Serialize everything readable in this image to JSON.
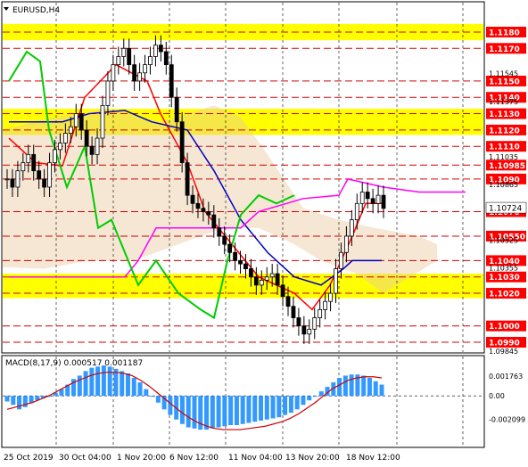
{
  "symbol_label": "EURUSD,H4",
  "macd_label": "MACD(8,17,9) 0.000517 0.001187",
  "price_scale": [
    1.1198,
    1.0984
  ],
  "macd_scale": [
    0.0035,
    -0.0045
  ],
  "colors": {
    "zone": "#ffff00",
    "redline": "#d40000",
    "candle_up": "#000000",
    "candle_down": "#000000",
    "tenkan": "#ff0000",
    "kijun": "#0000c0",
    "chikou": "#00cc00",
    "senkou_span_b": "#ff00ff",
    "kumo": "#e8c9a0",
    "macd_hist": "#3399ff",
    "macd_signal": "#cc0000",
    "label_bg": "#ff0000",
    "label_text": "#ffffff"
  },
  "levels": [
    {
      "price": "1.1180",
      "value": 1.118,
      "zone": true
    },
    {
      "price": "1.1170",
      "value": 1.117
    },
    {
      "price": "1.1150",
      "value": 1.115
    },
    {
      "price": "1.1140",
      "value": 1.114
    },
    {
      "price": "1.1130",
      "value": 1.113,
      "zone": true
    },
    {
      "price": "1.1120",
      "value": 1.112,
      "zone": true
    },
    {
      "price": "1.1110",
      "value": 1.111
    },
    {
      "price": "1.10985",
      "value": 1.10985
    },
    {
      "price": "1.1090",
      "value": 1.109
    },
    {
      "price": "1.1070",
      "value": 1.107
    },
    {
      "price": "1.10550",
      "value": 1.1055
    },
    {
      "price": "1.1040",
      "value": 1.104
    },
    {
      "price": "1.1030",
      "value": 1.103,
      "zone": true
    },
    {
      "price": "1.1020",
      "value": 1.102,
      "zone": true
    },
    {
      "price": "1.1000",
      "value": 1.1
    },
    {
      "price": "1.0990",
      "value": 1.099
    }
  ],
  "price_axis_ticks": [
    {
      "text": "1.11545",
      "value": 1.11545
    },
    {
      "text": "1.11375",
      "value": 1.11375
    },
    {
      "text": "1.11035",
      "value": 1.11035
    },
    {
      "text": "1.10865",
      "value": 1.10865
    },
    {
      "text": "1.10355",
      "value": 1.10355
    },
    {
      "text": "1.10525",
      "value": 1.10525
    },
    {
      "text": "1.09845",
      "value": 1.09845
    }
  ],
  "current_price": {
    "text": "1.10724",
    "value": 1.10724
  },
  "macd_axis_ticks": [
    {
      "text": "0.001763",
      "value": 0.001763
    },
    {
      "text": "0.00",
      "value": 0.0
    },
    {
      "text": "-0.002099",
      "value": -0.002099
    }
  ],
  "time_labels": [
    "25 Oct 2019",
    "30 Oct 04:00",
    "1 Nov 20:00",
    "6 Nov 12:00",
    "11 Nov 04:00",
    "13 Nov 20:00",
    "18 Nov 12:00"
  ],
  "chart_data": {
    "type": "candlestick",
    "symbol": "EURUSD",
    "timeframe": "H4",
    "candles_close": [
      1.109,
      1.1085,
      1.1095,
      1.11,
      1.1105,
      1.1095,
      1.109,
      1.1085,
      1.11,
      1.1108,
      1.1112,
      1.1118,
      1.1122,
      1.113,
      1.112,
      1.111,
      1.1105,
      1.1115,
      1.1135,
      1.115,
      1.116,
      1.1165,
      1.117,
      1.116,
      1.115,
      1.1155,
      1.116,
      1.1165,
      1.1172,
      1.1168,
      1.116,
      1.114,
      1.1125,
      1.11,
      1.108,
      1.1075,
      1.1072,
      1.107,
      1.1068,
      1.106,
      1.1055,
      1.105,
      1.1045,
      1.104,
      1.1038,
      1.1035,
      1.103,
      1.1025,
      1.1028,
      1.103,
      1.1032,
      1.1025,
      1.1018,
      1.1012,
      1.1005,
      1.1,
      1.0995,
      1.0998,
      1.1005,
      1.101,
      1.1015,
      1.102,
      1.1035,
      1.1045,
      1.1055,
      1.1065,
      1.1075,
      1.1082,
      1.1078,
      1.1075,
      1.108,
      1.1072
    ],
    "macd_hist": [
      -0.0005,
      -0.0008,
      -0.0012,
      -0.001,
      -0.0006,
      -0.0004,
      -0.0002,
      0.0,
      0.0003,
      0.0006,
      0.001,
      0.0015,
      0.0018,
      0.0022,
      0.0025,
      0.0026,
      0.0027,
      0.0026,
      0.0024,
      0.0022,
      0.002,
      0.0016,
      0.0012,
      0.0006,
      0.0,
      -0.0006,
      -0.0012,
      -0.0017,
      -0.0021,
      -0.0025,
      -0.0028,
      -0.0029,
      -0.003,
      -0.003,
      -0.0029,
      -0.0028,
      -0.0027,
      -0.0026,
      -0.0026,
      -0.0025,
      -0.0024,
      -0.0023,
      -0.0022,
      -0.0021,
      -0.002,
      -0.0019,
      -0.0017,
      -0.0015,
      -0.0012,
      -0.0008,
      -0.0004,
      0.0,
      0.0004,
      0.0008,
      0.0012,
      0.0016,
      0.0018,
      0.0019,
      0.0019,
      0.0018,
      0.0016,
      0.0013,
      0.001
    ],
    "macd_signal": [
      -0.0012,
      -0.001,
      -0.0008,
      -0.0006,
      -0.0003,
      0.0,
      0.0004,
      0.0008,
      0.0012,
      0.0015,
      0.0018,
      0.002,
      0.0021,
      0.0021,
      0.002,
      0.0018,
      0.0014,
      0.0009,
      0.0003,
      -0.0003,
      -0.0009,
      -0.0015,
      -0.002,
      -0.0024,
      -0.0027,
      -0.0029,
      -0.003,
      -0.003,
      -0.003,
      -0.0029,
      -0.0028,
      -0.0027,
      -0.0025,
      -0.0023,
      -0.002,
      -0.0016,
      -0.0011,
      -0.0006,
      0.0,
      0.0006,
      0.001,
      0.0014,
      0.0016,
      0.0017,
      0.0017,
      0.0016
    ],
    "ylim": [
      1.0984,
      1.1198
    ]
  }
}
